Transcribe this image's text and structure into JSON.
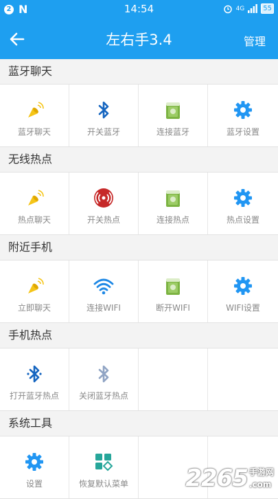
{
  "status_bar": {
    "badge": "2",
    "logo": "N",
    "time": "14:54",
    "network": "4G",
    "battery": "55"
  },
  "app_bar": {
    "title": "左右手3.4",
    "action": "管理",
    "back_icon": "arrow-left-icon"
  },
  "sections": [
    {
      "header": "蓝牙聊天",
      "items": [
        {
          "label": "蓝牙聊天",
          "icon": "megaphone-icon"
        },
        {
          "label": "开关蓝牙",
          "icon": "bluetooth-icon"
        },
        {
          "label": "连接蓝牙",
          "icon": "book-icon"
        },
        {
          "label": "蓝牙设置",
          "icon": "gear-icon"
        }
      ]
    },
    {
      "header": "无线热点",
      "items": [
        {
          "label": "热点聊天",
          "icon": "megaphone-icon"
        },
        {
          "label": "开关热点",
          "icon": "hotspot-icon"
        },
        {
          "label": "连接热点",
          "icon": "book-icon"
        },
        {
          "label": "热点设置",
          "icon": "gear-icon"
        }
      ]
    },
    {
      "header": "附近手机",
      "items": [
        {
          "label": "立即聊天",
          "icon": "megaphone-icon"
        },
        {
          "label": "连接WIFI",
          "icon": "wifi-icon"
        },
        {
          "label": "断开WIFI",
          "icon": "book-icon"
        },
        {
          "label": "WIFI设置",
          "icon": "gear-icon"
        }
      ]
    },
    {
      "header": "手机热点",
      "items": [
        {
          "label": "打开蓝牙热点",
          "icon": "bluetooth-active-icon"
        },
        {
          "label": "关闭蓝牙热点",
          "icon": "bluetooth-off-icon"
        },
        {
          "label": "",
          "icon": ""
        },
        {
          "label": "",
          "icon": ""
        }
      ]
    },
    {
      "header": "系统工具",
      "items": [
        {
          "label": "设置",
          "icon": "gear-icon"
        },
        {
          "label": "恢复默认菜单",
          "icon": "grid-restore-icon"
        },
        {
          "label": "",
          "icon": ""
        },
        {
          "label": "",
          "icon": ""
        }
      ]
    }
  ],
  "watermark": {
    "number": "2265",
    "site": "手游网",
    "domain": ".com"
  },
  "colors": {
    "primary": "#1e9ff0",
    "megaphone": "#f5c518",
    "bluetooth": "#1565c0",
    "gear": "#2196f3",
    "book": "#7cb342",
    "hotspot": "#c62828",
    "wifi": "#1e88e5"
  }
}
